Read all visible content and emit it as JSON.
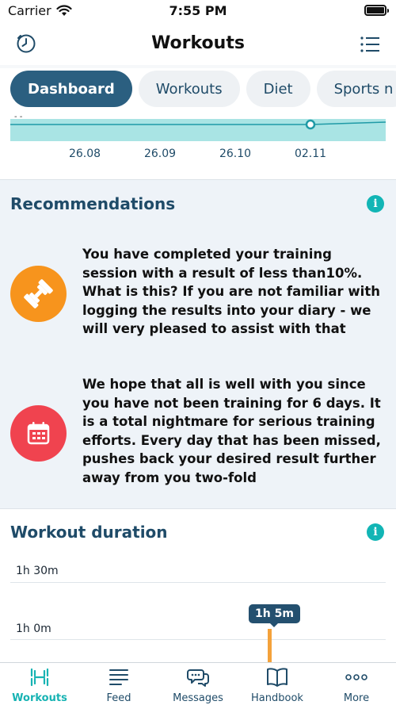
{
  "status": {
    "carrier": "Carrier",
    "time": "7:55 PM",
    "battery_level": 1.0
  },
  "nav": {
    "title": "Workouts",
    "left_icon": "clock-icon",
    "right_icon": "list-icon"
  },
  "tabs": [
    {
      "label": "Dashboard",
      "active": true
    },
    {
      "label": "Workouts",
      "active": false
    },
    {
      "label": "Diet",
      "active": false
    },
    {
      "label": "Sports n",
      "active": false
    }
  ],
  "top_chart": {
    "x_ticks": [
      "26.08",
      "26.09",
      "26.10",
      "02.11"
    ],
    "accent": "#a9e4e4",
    "point_color": "#1f9aa6"
  },
  "recommendations": {
    "title": "Recommendations",
    "items": [
      {
        "icon": "dumbbell-icon",
        "color": "#f7941d",
        "text": "You have completed your training session with a result of less than10%. What is this? If you are not familiar with logging the results into your diary - we will very pleased to assist with that"
      },
      {
        "icon": "calendar-icon",
        "color": "#f0434f",
        "text": "We hope that all is well with you since you have not been training for 6 days. It is a total nightmare for serious training efforts. Every day that has been missed, pushes back your desired result further away from you two-fold"
      }
    ]
  },
  "duration": {
    "title": "Workout duration",
    "y_labels": [
      "1h 30m",
      "1h 0m"
    ],
    "bubble": "1h 5m",
    "bar_color": "#f4a23b"
  },
  "tabbar": [
    {
      "label": "Workouts",
      "icon": "dumbbell-icon",
      "active": true
    },
    {
      "label": "Feed",
      "icon": "feed-icon",
      "active": false
    },
    {
      "label": "Messages",
      "icon": "messages-icon",
      "active": false
    },
    {
      "label": "Handbook",
      "icon": "book-icon",
      "active": false
    },
    {
      "label": "More",
      "icon": "more-icon",
      "active": false
    }
  ]
}
